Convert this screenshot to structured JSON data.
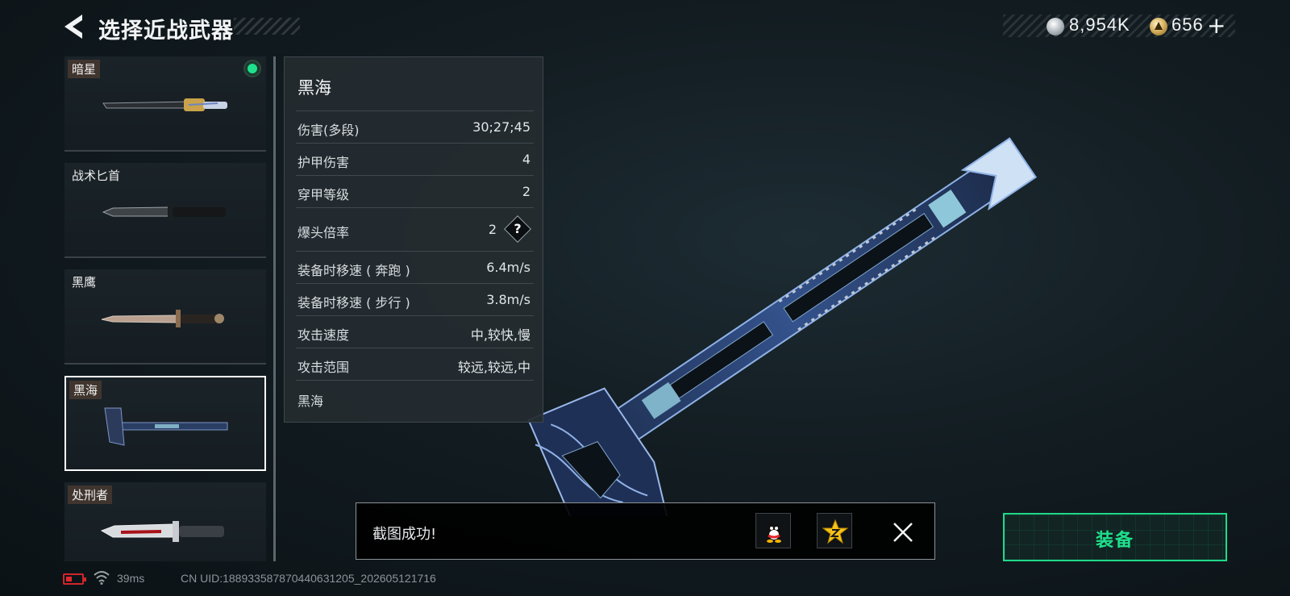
{
  "header": {
    "title": "选择近战武器"
  },
  "currency": {
    "coins": "8,954K",
    "gold": "656",
    "plus": "+"
  },
  "weapons": [
    {
      "name": "暗星",
      "equipped": true
    },
    {
      "name": "战术匕首"
    },
    {
      "name": "黑鹰"
    },
    {
      "name": "黑海",
      "selected": true
    },
    {
      "name": "处刑者"
    }
  ],
  "stats_panel": {
    "title": "黑海",
    "rows": [
      {
        "label": "伤害(多段)",
        "value": "30;27;45"
      },
      {
        "label": "护甲伤害",
        "value": "4"
      },
      {
        "label": "穿甲等级",
        "value": "2"
      },
      {
        "label": "爆头倍率",
        "value": "2",
        "help": "?"
      },
      {
        "label": "装备时移速 ( 奔跑 )",
        "value": "6.4m/s"
      },
      {
        "label": "装备时移速 ( 步行 )",
        "value": "3.8m/s"
      },
      {
        "label": "攻击速度",
        "value": "中,较快,慢"
      },
      {
        "label": "攻击范围",
        "value": "较远,较远,中"
      }
    ],
    "footer": "黑海"
  },
  "toast": {
    "message": "截图成功!"
  },
  "equip_button": {
    "label": "装备"
  },
  "status_bar": {
    "ping": "39ms",
    "uid": "CN UID:1889335878704406312​05_202605121716"
  },
  "colors": {
    "accent_green": "#1fe08c",
    "battery_low": "#d0262b",
    "background": "#121c21"
  },
  "icons": [
    "back-arrow-icon",
    "silver-coin-icon",
    "gold-coin-icon",
    "qq-icon",
    "qzone-icon",
    "close-icon",
    "battery-icon",
    "wifi-icon"
  ]
}
